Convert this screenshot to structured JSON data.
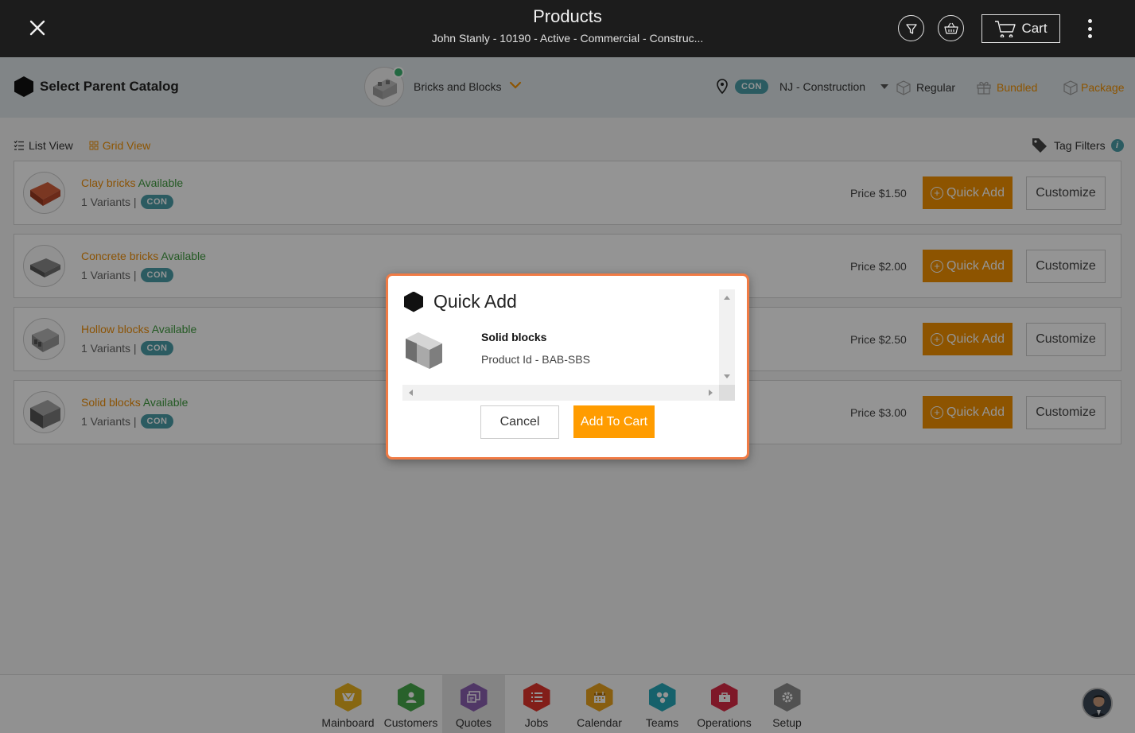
{
  "header": {
    "title": "Products",
    "subtitle": "John Stanly - 10190 - Active - Commercial - Construc...",
    "cart_label": "Cart"
  },
  "catalog_bar": {
    "parent_catalog_label": "Select Parent Catalog",
    "catalog_name": "Bricks and Blocks",
    "location_badge": "CON",
    "location_name": "NJ - Construction",
    "modes": [
      "Regular",
      "Bundled",
      "Package"
    ]
  },
  "view": {
    "list_view": "List View",
    "grid_view": "Grid View",
    "tag_filters": "Tag Filters",
    "info": "i"
  },
  "products": [
    {
      "name": "Clay bricks",
      "status": "Available",
      "variants": "1 Variants |",
      "badge": "CON",
      "price": "Price $1.50",
      "quick_add": "Quick Add",
      "customize": "Customize",
      "color": "#b8492b"
    },
    {
      "name": "Concrete bricks",
      "status": "Available",
      "variants": "1 Variants |",
      "badge": "CON",
      "price": "Price $2.00",
      "quick_add": "Quick Add",
      "customize": "Customize",
      "color": "#6f6f6f"
    },
    {
      "name": "Hollow blocks",
      "status": "Available",
      "variants": "1 Variants |",
      "badge": "CON",
      "price": "Price $2.50",
      "quick_add": "Quick Add",
      "customize": "Customize",
      "color": "#9a9a9a"
    },
    {
      "name": "Solid blocks",
      "status": "Available",
      "variants": "1 Variants |",
      "badge": "CON",
      "price": "Price $3.00",
      "quick_add": "Quick Add",
      "customize": "Customize",
      "color": "#7a7a7a"
    }
  ],
  "modal": {
    "title": "Quick Add",
    "product_name": "Solid blocks",
    "product_id": "Product Id - BAB-SBS",
    "cancel": "Cancel",
    "add_to_cart": "Add To Cart"
  },
  "bottom_nav": [
    {
      "label": "Mainboard",
      "color": "#e8b21e",
      "icon": "mainboard-icon"
    },
    {
      "label": "Customers",
      "color": "#45a84a",
      "icon": "customers-icon"
    },
    {
      "label": "Quotes",
      "color": "#8a5fb0",
      "icon": "quotes-icon",
      "active": true
    },
    {
      "label": "Jobs",
      "color": "#e0342c",
      "icon": "jobs-icon"
    },
    {
      "label": "Calendar",
      "color": "#e8a21e",
      "icon": "calendar-icon"
    },
    {
      "label": "Teams",
      "color": "#27a8b8",
      "icon": "teams-icon"
    },
    {
      "label": "Operations",
      "color": "#d92a45",
      "icon": "operations-icon"
    },
    {
      "label": "Setup",
      "color": "#8c8c8c",
      "icon": "setup-icon"
    }
  ],
  "colors": {
    "accent": "#f39200",
    "badge": "#4a9ea8",
    "available": "#3f9b3f",
    "modal_border": "#f07b45"
  }
}
